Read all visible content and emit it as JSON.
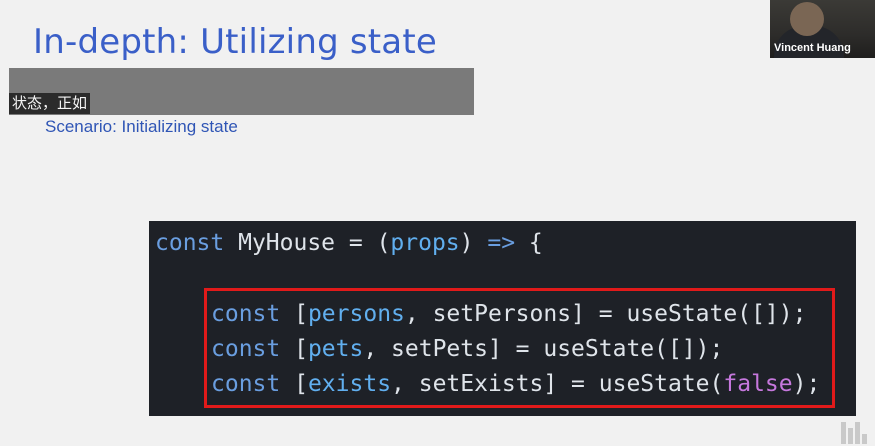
{
  "slide": {
    "title": "In-depth: Utilizing state",
    "subtitle_caption": "状态，正如",
    "scenario": "Scenario: Initializing state"
  },
  "code": {
    "line1": {
      "kw": "const",
      "name": " MyHouse = (",
      "arg": "props",
      "rest": ") ",
      "arrow": "=>",
      "brace": " {"
    },
    "line2": {
      "kw": "const",
      "open": " [",
      "var": "persons",
      "mid": ", setPersons] = useState([]);"
    },
    "line3": {
      "kw": "const",
      "open": " [",
      "var": "pets",
      "mid": ", setPets] = useState([]);"
    },
    "line4": {
      "kw": "const",
      "open": " [",
      "var": "exists",
      "mid": ", setExists] = useState(",
      "lit": "false",
      "end": ");"
    }
  },
  "webcam": {
    "participant_name": "Vincent Huang"
  },
  "colors": {
    "title": "#3a5fc8",
    "highlight_border": "#e11a1a",
    "code_bg": "#1e2127"
  }
}
